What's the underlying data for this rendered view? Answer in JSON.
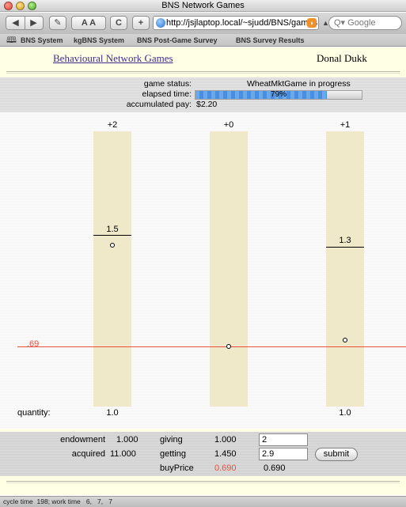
{
  "window": {
    "title": "BNS Network Games"
  },
  "toolbar": {
    "back_glyph": "◀",
    "forward_glyph": "▶",
    "edit_glyph": "✎",
    "text_size_label": "A A",
    "reload_glyph": "C",
    "add_glyph": "+",
    "url": "http://jsjlaptop.local/~sjudd/BNS/games",
    "search_placeholder": "Q▾ Google"
  },
  "bookmarks": [
    "BNS System",
    "kgBNS System",
    "BNS Post-Game Survey",
    "BNS Survey Results"
  ],
  "header": {
    "link": "Behavioural Network Games",
    "user": "Donal Dukk"
  },
  "status": {
    "game_status_label": "game status:",
    "game_status_value": "WheatMktGame in progress",
    "elapsed_label": "elapsed time:",
    "elapsed_percent_text": "79%",
    "elapsed_fraction": 0.79,
    "pay_label": "accumulated pay:",
    "pay_value": "$2.20"
  },
  "game": {
    "price_line_label": ".69",
    "columns": [
      {
        "head": "+2",
        "level_label": "1.5",
        "quantity": "1.0"
      },
      {
        "head": "+0",
        "level_label": "",
        "quantity": ""
      },
      {
        "head": "+1",
        "level_label": "1.3",
        "quantity": "1.0"
      }
    ],
    "quantity_label": "quantity:"
  },
  "controls": {
    "endowment_label": "endowment",
    "endowment_value": "1.000",
    "acquired_label": "acquired",
    "acquired_value": "11.000",
    "giving_label": "giving",
    "giving_value": "1.000",
    "giving_input": "2",
    "getting_label": "getting",
    "getting_value": "1.450",
    "getting_input": "2.9",
    "buyprice_label": "buyPrice",
    "buyprice_value": "0.690",
    "buyprice_value2": "0.690",
    "submit_label": "submit"
  },
  "statusbar": {
    "text": "cycle time  198; work time   6,   7,   7"
  },
  "colors": {
    "price_line": "#e8503c",
    "column_fill": "#efe9c9",
    "progress_fill": "#4a8ee0",
    "link": "#3d2c8c"
  }
}
